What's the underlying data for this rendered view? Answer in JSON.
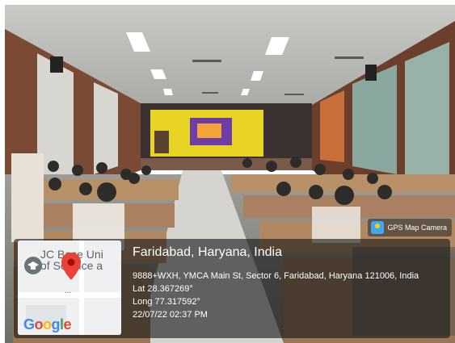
{
  "badge": {
    "label": "GPS Map Camera",
    "icon": "gps-map-camera-icon"
  },
  "map": {
    "label_line1": "JC Bose Uni",
    "label_line2": "of Science a",
    "tag": "...",
    "logo": "Google",
    "logo_colors": [
      "#4285F4",
      "#EA4335",
      "#FBBC05",
      "#4285F4",
      "#34A853",
      "#EA4335"
    ],
    "pin_color": "#ea4335",
    "icons": [
      "education-pin-icon",
      "location-pin-icon"
    ]
  },
  "location": {
    "place": "Faridabad, Haryana, India",
    "address": "9888+WXH, YMCA Main St, Sector 6, Faridabad, Haryana 121006, India",
    "lat": "Lat 28.367269°",
    "long": "Long 77.317592°",
    "datetime": "22/07/22 02:37 PM"
  }
}
